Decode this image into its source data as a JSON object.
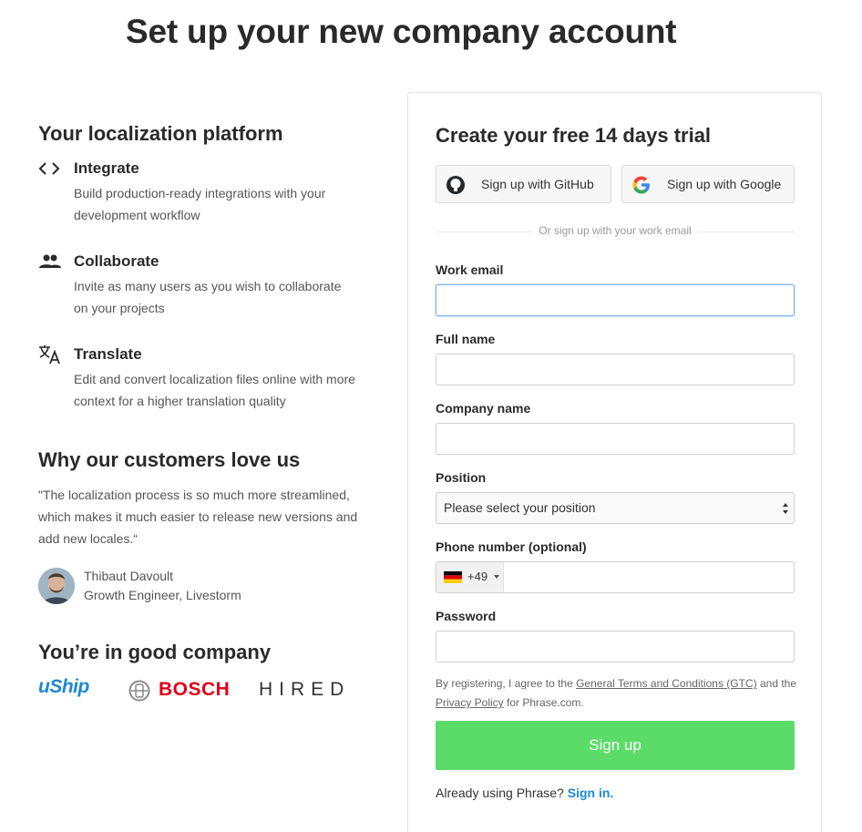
{
  "page_title": "Set up your new company account",
  "left": {
    "platform_heading": "Your localization platform",
    "features": [
      {
        "icon": "code-icon",
        "title": "Integrate",
        "desc_line1": "Build production-ready integrations with your",
        "desc_line2": "development workflow"
      },
      {
        "icon": "people-icon",
        "title": "Collaborate",
        "desc_line1": "Invite as many users as you wish to collaborate",
        "desc_line2": "on your projects"
      },
      {
        "icon": "translate-icon",
        "title": "Translate",
        "desc_line1": "Edit and convert localization files online with more",
        "desc_line2": "context for a higher translation quality"
      }
    ],
    "customers_heading": "Why our customers love us",
    "quote_line1": "\"The localization process is so much more streamlined,",
    "quote_line2": "which makes it much easier to release new versions and",
    "quote_line3": "add new locales.“",
    "person_name": "Thibaut Davoult",
    "person_role": "Growth Engineer, Livestorm",
    "company_heading": "You’re in good company",
    "logos": [
      "uShip",
      "BOSCH",
      "HIRED"
    ]
  },
  "form": {
    "title": "Create your free 14 days trial",
    "github_label": "Sign up with GitHub",
    "google_label": "Sign up with Google",
    "divider_text": "Or sign up with your work email",
    "email_label": "Work email",
    "email_value": "",
    "name_label": "Full name",
    "name_value": "",
    "company_label": "Company name",
    "company_value": "",
    "position_label": "Position",
    "position_value": "Please select your position",
    "phone_label": "Phone number (optional)",
    "phone_dial_code": "+49",
    "phone_value": "",
    "password_label": "Password",
    "password_value": "",
    "terms_prefix": "By registering, I agree to the",
    "terms_link": "General Terms and Conditions (GTC)",
    "terms_and": "and the",
    "privacy_link": "Privacy Policy",
    "terms_suffix": "for Phrase.com.",
    "signup_label": "Sign up",
    "already_text": "Already using Phrase?",
    "signin_link": "Sign in."
  },
  "colors": {
    "signup_green": "#5bdc68",
    "link_blue": "#1c8ad6",
    "bosch_red": "#e2001a",
    "uship_blue": "#1d88d0"
  }
}
